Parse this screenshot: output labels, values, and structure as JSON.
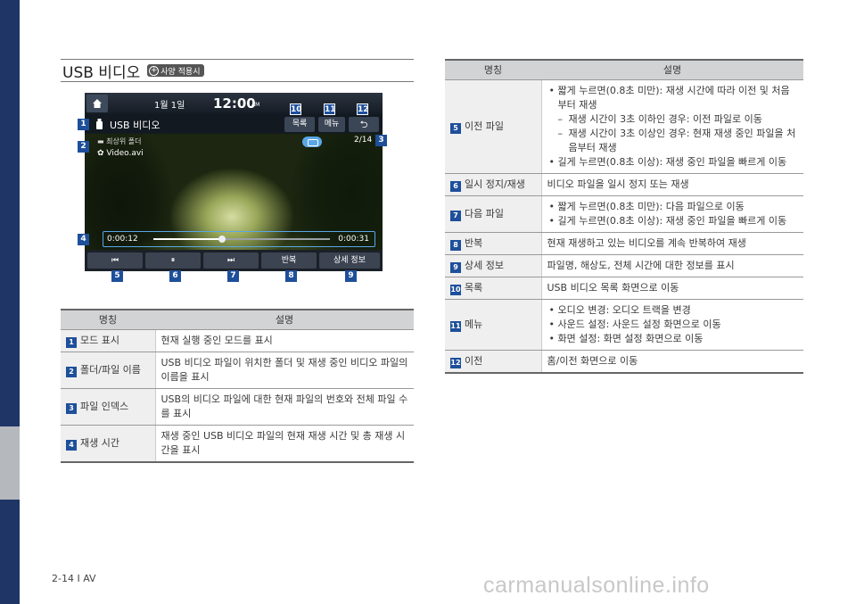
{
  "page": {
    "section_title": "USB 비디오",
    "badge_plus": "+",
    "badge_label": "사양 적용시",
    "page_number": "2-14 I AV",
    "watermark": "carmanualsonline.info"
  },
  "screen": {
    "date": "1월  1일",
    "time": "12:00",
    "ampm": "AM",
    "usb_title": "USB 비디오",
    "list_button": "목록",
    "menu_button": "메뉴",
    "back_button": "⮌",
    "folder": "최상위 폴더",
    "file": "Video.avi",
    "file_index": "2/14",
    "time_current": "0:00:12",
    "time_total": "0:00:31",
    "progress_fraction": 0.39,
    "prev_button": "⏮",
    "pause_button": "⏸",
    "next_button": "⏭",
    "repeat_button": "반복",
    "info_button": "상세 정보"
  },
  "callouts": [
    "1",
    "2",
    "3",
    "4",
    "5",
    "6",
    "7",
    "8",
    "9",
    "10",
    "11",
    "12"
  ],
  "left_table": {
    "headers": [
      "명칭",
      "설명"
    ],
    "rows": [
      {
        "num": "1",
        "name": "모드 표시",
        "desc": "현재 실행 중인 모드를 표시"
      },
      {
        "num": "2",
        "name": "폴더/파일 이름",
        "desc": "USB 비디오 파일이 위치한 폴더 및 재생 중인 비디오 파일의 이름을 표시"
      },
      {
        "num": "3",
        "name": "파일 인덱스",
        "desc": "USB의 비디오 파일에 대한 현재 파일의 번호와 전체 파일 수를 표시"
      },
      {
        "num": "4",
        "name": "재생 시간",
        "desc": "재생 중인 USB 비디오 파일의 현재 재생 시간 및 총 재생 시간을 표시"
      }
    ]
  },
  "right_table": {
    "headers": [
      "명칭",
      "설명"
    ],
    "rows": [
      {
        "num": "5",
        "name": "이전 파일",
        "b1": "짧게 누르면(0.8초 미만): 재생 시간에 따라 이전 및 처음부터 재생",
        "d1": "재생 시간이 3초 이하인 경우: 이전 파일로 이동",
        "d2": "재생 시간이 3초 이상인 경우: 현재 재생 중인 파일을 처음부터 재생",
        "b2": "길게 누르면(0.8초 이상): 재생 중인 파일을 빠르게 이동"
      },
      {
        "num": "6",
        "name": "일시 정지/재생",
        "desc": "비디오 파일을 일시 정지 또는 재생"
      },
      {
        "num": "7",
        "name": "다음 파일",
        "b1": "짧게 누르면(0.8초 미만): 다음 파일으로 이동",
        "b2": "길게 누르면(0.8초 이상): 재생 중인 파일을 빠르게 이동"
      },
      {
        "num": "8",
        "name": "반복",
        "desc": "현재 재생하고 있는 비디오를 계속 반복하여 재생"
      },
      {
        "num": "9",
        "name": "상세 정보",
        "desc": "파일명, 해상도, 전체 시간에 대한 정보를 표시"
      },
      {
        "num": "10",
        "name": "목록",
        "desc": "USB 비디오 목록 화면으로 이동"
      },
      {
        "num": "11",
        "name": "메뉴",
        "b1": "오디오 변경: 오디오 트랙을 변경",
        "b2": "사운드 설정: 사운드 설정 화면으로 이동",
        "b3": "화면 설정: 화면 설정 화면으로 이동"
      },
      {
        "num": "12",
        "name": "이전",
        "desc": "홈/이전 화면으로 이동"
      }
    ]
  }
}
